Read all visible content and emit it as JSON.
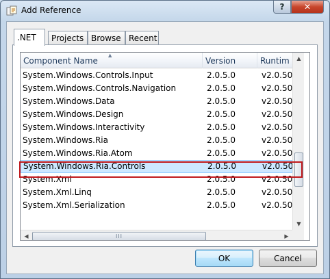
{
  "window": {
    "title": "Add Reference",
    "help_label": "?",
    "close_label": "✕"
  },
  "tabs": [
    {
      "label": ".NET",
      "active": true
    },
    {
      "label": "Projects",
      "active": false
    },
    {
      "label": "Browse",
      "active": false
    },
    {
      "label": "Recent",
      "active": false
    }
  ],
  "list": {
    "columns": [
      "Component Name",
      "Version",
      "Runtim"
    ],
    "sort_indicator": "▲",
    "rows": [
      {
        "name": "System.Windows.Controls.Input",
        "version": "2.0.5.0",
        "runtime": "v2.0.50"
      },
      {
        "name": "System.Windows.Controls.Navigation",
        "version": "2.0.5.0",
        "runtime": "v2.0.50"
      },
      {
        "name": "System.Windows.Data",
        "version": "2.0.5.0",
        "runtime": "v2.0.50"
      },
      {
        "name": "System.Windows.Design",
        "version": "2.0.5.0",
        "runtime": "v2.0.50"
      },
      {
        "name": "System.Windows.Interactivity",
        "version": "2.0.5.0",
        "runtime": "v2.0.50"
      },
      {
        "name": "System.Windows.Ria",
        "version": "2.0.5.0",
        "runtime": "v2.0.50"
      },
      {
        "name": "System.Windows.Ria.Atom",
        "version": "2.0.5.0",
        "runtime": "v2.0.50"
      },
      {
        "name": "System.Windows.Ria.Controls",
        "version": "2.0.5.0",
        "runtime": "v2.0.50",
        "selected": true
      },
      {
        "name": "System.Xml",
        "version": "2.0.5.0",
        "runtime": "v2.0.50"
      },
      {
        "name": "System.Xml.Linq",
        "version": "2.0.5.0",
        "runtime": "v2.0.50"
      },
      {
        "name": "System.Xml.Serialization",
        "version": "2.0.5.0",
        "runtime": "v2.0.50"
      }
    ]
  },
  "scroll": {
    "up": "▲",
    "down": "▼",
    "left": "◀",
    "right": "▶",
    "grip": "III"
  },
  "buttons": {
    "ok": "OK",
    "cancel": "Cancel"
  },
  "colors": {
    "selection": "#cde8ff",
    "highlight_box": "#c0191c",
    "close_button": "#c8462c"
  }
}
